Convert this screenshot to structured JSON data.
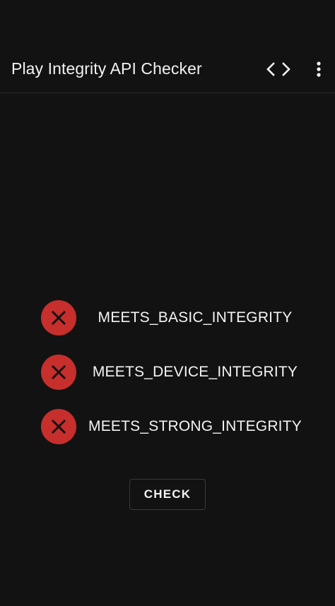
{
  "app_bar": {
    "title": "Play Integrity API Checker",
    "actions": [
      {
        "icon": "code-icon"
      },
      {
        "icon": "more-vert-icon"
      }
    ]
  },
  "checks": [
    {
      "label": "MEETS_BASIC_INTEGRITY",
      "status": "fail",
      "icon": "close-icon"
    },
    {
      "label": "MEETS_DEVICE_INTEGRITY",
      "status": "fail",
      "icon": "close-icon"
    },
    {
      "label": "MEETS_STRONG_INTEGRITY",
      "status": "fail",
      "icon": "close-icon"
    }
  ],
  "check_button": {
    "label": "CHECK"
  },
  "colors": {
    "background": "#121212",
    "fail": "#c62f2b",
    "text": "#f4f4f4",
    "divider": "#2c2c2c"
  }
}
